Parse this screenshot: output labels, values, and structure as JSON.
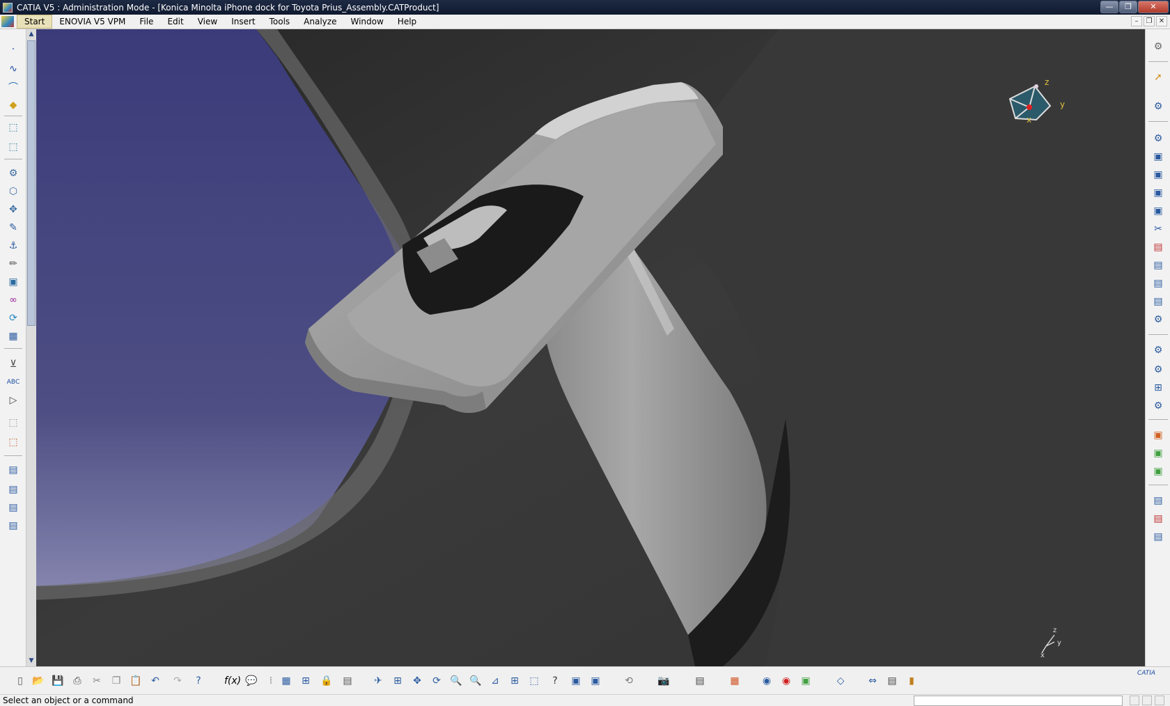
{
  "window": {
    "title": "CATIA V5 : Administration Mode - [Konica Minolta iPhone dock for Toyota Prius_Assembly.CATProduct]",
    "minimize": "—",
    "maximize": "❐",
    "close": "✕"
  },
  "menu": {
    "items": [
      "Start",
      "ENOVIA V5 VPM",
      "File",
      "Edit",
      "View",
      "Insert",
      "Tools",
      "Analyze",
      "Window",
      "Help"
    ],
    "doc_minimize": "–",
    "doc_restore": "❐",
    "doc_close": "✕"
  },
  "compass": {
    "x_label": "x",
    "y_label": "y",
    "z_label": "z"
  },
  "axis_triad": {
    "x_label": "x",
    "y_label": "y",
    "z_label": "z"
  },
  "brand": {
    "logo_text": "CATIA"
  },
  "status": {
    "message": "Select an object or a command"
  },
  "colors": {
    "background_top": "#3c3c78",
    "background_bottom": "#8888b0",
    "part_gray": "#9a9a9a",
    "dark_part": "#2e2e2e"
  }
}
